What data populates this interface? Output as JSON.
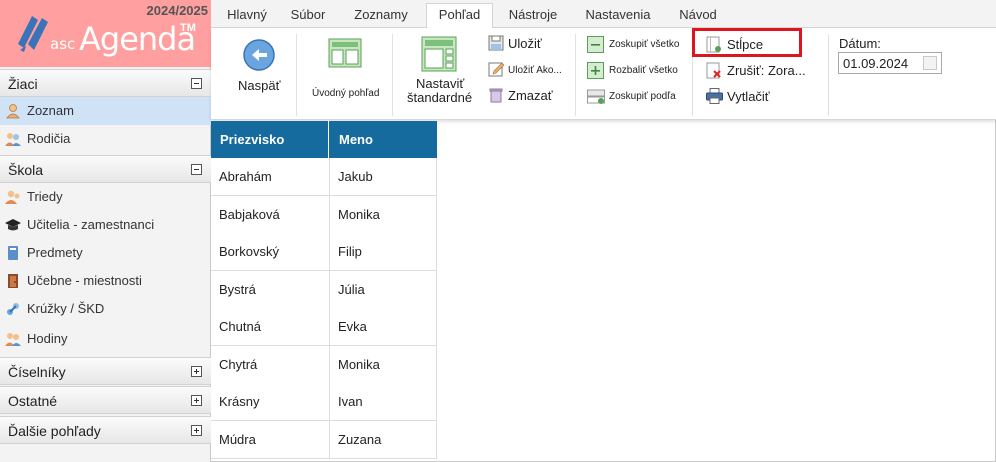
{
  "brand": {
    "year": "2024/2025",
    "logo_asc": "asc",
    "logo_agenda": "Agenda",
    "logo_tm": "TM"
  },
  "sidebar": {
    "sections": [
      {
        "label": "Žiaci",
        "state": "expanded"
      },
      {
        "label": "Škola",
        "state": "expanded"
      },
      {
        "label": "Číselníky",
        "state": "collapsed"
      },
      {
        "label": "Ostatné",
        "state": "collapsed"
      },
      {
        "label": "Ďalšie pohľady",
        "state": "collapsed"
      }
    ],
    "items": [
      {
        "label": "Zoznam",
        "icon": "student-icon",
        "active": true
      },
      {
        "label": "Rodičia",
        "icon": "parents-icon"
      },
      {
        "label": "Triedy",
        "icon": "classes-icon"
      },
      {
        "label": "Učitelia - zamestnanci",
        "icon": "teacher-icon"
      },
      {
        "label": "Predmety",
        "icon": "subject-icon"
      },
      {
        "label": "Učebne - miestnosti",
        "icon": "room-icon"
      },
      {
        "label": "Krúžky / ŠKD",
        "icon": "clubs-icon"
      },
      {
        "label": "Hodiny",
        "icon": "lessons-icon"
      }
    ]
  },
  "tabs": [
    "Hlavný",
    "Súbor",
    "Zoznamy",
    "Pohľad",
    "Nástroje",
    "Nastavenia",
    "Návod"
  ],
  "active_tab": "Pohľad",
  "ribbon": {
    "back": "Naspäť",
    "home_view": "Úvodný pohľad",
    "set_default_line1": "Nastaviť",
    "set_default_line2": "štandardné",
    "save": "Uložiť",
    "save_as": "Uložiť Ako...",
    "delete": "Zmazať",
    "group_all": "Zoskupiť všetko",
    "expand_all": "Rozbaliť všetko",
    "group_by": "Zoskupiť podľa",
    "columns": "Stĺpce",
    "cancel_sort": "Zrušiť: Zora...",
    "print": "Vytlačiť",
    "date_label": "Dátum:",
    "date_value": "01.09.2024"
  },
  "table": {
    "columns": [
      "Priezvisko",
      "Meno"
    ],
    "rows": [
      [
        "Abrahám",
        "Jakub"
      ],
      [
        "Babjaková",
        "Monika"
      ],
      [
        "Borkovský",
        "Filip"
      ],
      [
        "Bystrá",
        "Júlia"
      ],
      [
        "Chutná",
        "Evka"
      ],
      [
        "Chytrá",
        "Monika"
      ],
      [
        "Krásny",
        "Ivan"
      ],
      [
        "Múdra",
        "Zuzana"
      ]
    ]
  },
  "colors": {
    "accent": "#156b9e",
    "brand": "#ff9f9f",
    "highlight": "#e0141e",
    "active_item": "#cfe2f6"
  }
}
